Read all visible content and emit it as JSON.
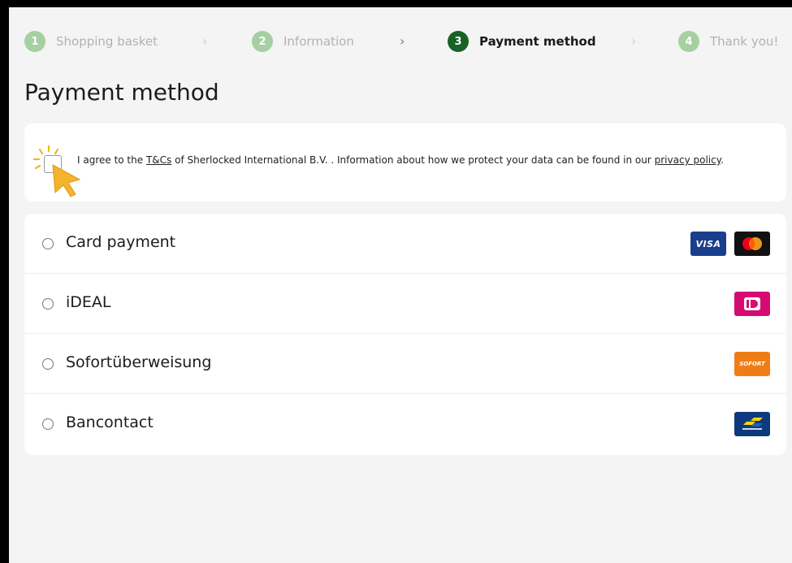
{
  "stepper": {
    "steps": [
      {
        "number": "1",
        "label": "Shopping basket",
        "state": "done"
      },
      {
        "number": "2",
        "label": "Information",
        "state": "done"
      },
      {
        "number": "3",
        "label": "Payment method",
        "state": "active"
      },
      {
        "number": "4",
        "label": "Thank you!",
        "state": "upcoming"
      }
    ]
  },
  "page_title": "Payment method",
  "terms": {
    "text_before": "I agree to the ",
    "tcs_link": "T&Cs",
    "text_middle": " of Sherlocked International B.V. . Information about how we protect your data can be found in our ",
    "privacy_link": "privacy policy",
    "text_after": ".",
    "checked": false
  },
  "payment_methods": [
    {
      "label": "Card payment",
      "logos": [
        "VISA",
        "mastercard-icon"
      ]
    },
    {
      "label": "iDEAL",
      "logos": [
        "ideal-icon"
      ]
    },
    {
      "label": "Sofortüberweisung",
      "logos": [
        "SOFORT"
      ]
    },
    {
      "label": "Bancontact",
      "logos": [
        "bancontact-icon"
      ]
    }
  ],
  "colors": {
    "active_step": "#186226",
    "done_step": "#a6cfa2",
    "cursor": "#f4b32a",
    "visa": "#1a3e8c",
    "ideal": "#d50b72",
    "sofort": "#ef7d16",
    "bancontact": "#0d3a7e"
  }
}
